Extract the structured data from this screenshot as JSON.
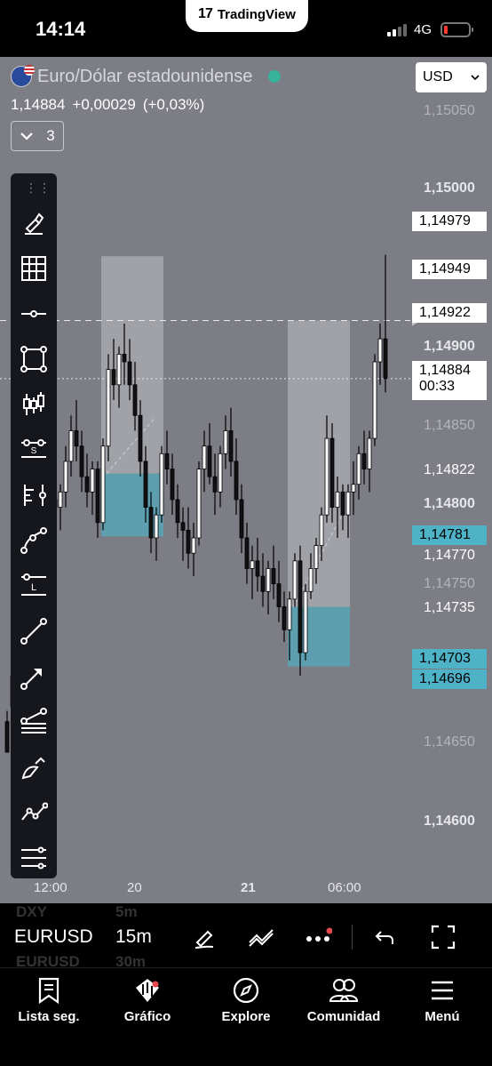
{
  "status_bar": {
    "time": "14:14",
    "app_pill_logo": "17",
    "app_pill_name": "TradingView",
    "network": "4G"
  },
  "symbol": {
    "name": "Euro/Dólar estadounidense",
    "price": "1,14884",
    "change": "+0,00029",
    "change_pct": "(+0,03%)",
    "indicators_count": "3",
    "currency": "USD",
    "market_status_color": "#36b39a"
  },
  "chart_data": {
    "type": "candlestick",
    "instrument": "EURUSD",
    "interval": "15m",
    "ylim": [
      1.14593,
      1.15064
    ],
    "price_axis_ticks": [
      "1,15050",
      "1,15000",
      "1,14950",
      "1,14900",
      "1,14850",
      "1,14800",
      "1,14750",
      "1,14650",
      "1,14600"
    ],
    "price_axis_labels": [
      {
        "text": "1,14979",
        "style": "box"
      },
      {
        "text": "1,14949",
        "style": "box"
      },
      {
        "text": "1,14922",
        "style": "box"
      },
      {
        "text": "1,14884",
        "style": "box",
        "countdown": "00:33"
      },
      {
        "text": "1,14822",
        "style": "plain"
      },
      {
        "text": "1,14781",
        "style": "cyan"
      },
      {
        "text": "1,14770",
        "style": "plain"
      },
      {
        "text": "1,14735",
        "style": "plain"
      },
      {
        "text": "1,14703",
        "style": "cyan"
      },
      {
        "text": "1,14696",
        "style": "cyan"
      }
    ],
    "time_axis_ticks": [
      {
        "text": "12:00",
        "bold": false
      },
      {
        "text": "20",
        "bold": false
      },
      {
        "text": "21",
        "bold": true
      },
      {
        "text": "06:00",
        "bold": false
      }
    ],
    "horizontal_lines": [
      {
        "price": 1.14922,
        "style": "dashed"
      },
      {
        "price": 1.14884,
        "style": "dotted"
      }
    ],
    "position_boxes": [
      {
        "start": 18,
        "end": 29,
        "entry": 1.14822,
        "target": 1.14964,
        "stop": 1.14781
      },
      {
        "start": 53,
        "end": 64,
        "entry": 1.14735,
        "target": 1.14922,
        "stop": 1.14696
      }
    ],
    "candles": [
      [
        1.1466,
        1.14667,
        1.14645,
        1.1464
      ],
      [
        1.1467,
        1.147,
        1.1466,
        1.1469
      ],
      [
        1.147,
        1.1472,
        1.14685,
        1.1471
      ],
      [
        1.1471,
        1.148,
        1.147,
        1.1479
      ],
      [
        1.1479,
        1.14815,
        1.1477,
        1.148
      ],
      [
        1.148,
        1.1484,
        1.14785,
        1.1483
      ],
      [
        1.1483,
        1.14845,
        1.148,
        1.1481
      ],
      [
        1.1481,
        1.1483,
        1.1479,
        1.1482
      ],
      [
        1.1482,
        1.1484,
        1.148,
        1.14805
      ],
      [
        1.14805,
        1.1482,
        1.1479,
        1.148
      ],
      [
        1.148,
        1.14815,
        1.14785,
        1.1481
      ],
      [
        1.1481,
        1.1484,
        1.148,
        1.1483
      ],
      [
        1.1483,
        1.1486,
        1.1482,
        1.1485
      ],
      [
        1.1485,
        1.1487,
        1.1483,
        1.1484
      ],
      [
        1.1484,
        1.1485,
        1.1481,
        1.1482
      ],
      [
        1.1482,
        1.14835,
        1.148,
        1.1481
      ],
      [
        1.1481,
        1.1483,
        1.14795,
        1.14825
      ],
      [
        1.14825,
        1.1483,
        1.1478,
        1.1479
      ],
      [
        1.1479,
        1.14845,
        1.14785,
        1.1484
      ],
      [
        1.1484,
        1.149,
        1.1483,
        1.1489
      ],
      [
        1.1489,
        1.1491,
        1.1487,
        1.1488
      ],
      [
        1.1488,
        1.14905,
        1.14865,
        1.149
      ],
      [
        1.149,
        1.1492,
        1.1488,
        1.14895
      ],
      [
        1.14895,
        1.1491,
        1.1487,
        1.1488
      ],
      [
        1.1488,
        1.14895,
        1.1485,
        1.1486
      ],
      [
        1.1486,
        1.1487,
        1.1482,
        1.1483
      ],
      [
        1.1483,
        1.1484,
        1.1479,
        1.148
      ],
      [
        1.148,
        1.1481,
        1.1477,
        1.1478
      ],
      [
        1.1478,
        1.148,
        1.14765,
        1.14795
      ],
      [
        1.14795,
        1.1484,
        1.1479,
        1.14835
      ],
      [
        1.14835,
        1.1485,
        1.14815,
        1.14825
      ],
      [
        1.14825,
        1.14835,
        1.14795,
        1.14805
      ],
      [
        1.14805,
        1.14815,
        1.1478,
        1.1479
      ],
      [
        1.1479,
        1.148,
        1.14765,
        1.14785
      ],
      [
        1.14785,
        1.148,
        1.1476,
        1.1477
      ],
      [
        1.1477,
        1.1479,
        1.14755,
        1.1478
      ],
      [
        1.1478,
        1.1483,
        1.14775,
        1.14825
      ],
      [
        1.14825,
        1.1485,
        1.1481,
        1.1484
      ],
      [
        1.1484,
        1.14855,
        1.14815,
        1.1482
      ],
      [
        1.1482,
        1.14835,
        1.14795,
        1.1481
      ],
      [
        1.1481,
        1.1484,
        1.148,
        1.14835
      ],
      [
        1.14835,
        1.1486,
        1.14825,
        1.1485
      ],
      [
        1.1485,
        1.14865,
        1.1482,
        1.1483
      ],
      [
        1.1483,
        1.14845,
        1.14795,
        1.14805
      ],
      [
        1.14805,
        1.14815,
        1.1477,
        1.1478
      ],
      [
        1.1478,
        1.1479,
        1.1475,
        1.1476
      ],
      [
        1.1476,
        1.14775,
        1.1474,
        1.14765
      ],
      [
        1.14765,
        1.1478,
        1.14745,
        1.14755
      ],
      [
        1.14755,
        1.1477,
        1.14735,
        1.14745
      ],
      [
        1.14745,
        1.14765,
        1.1473,
        1.1476
      ],
      [
        1.1476,
        1.14775,
        1.1474,
        1.1475
      ],
      [
        1.1475,
        1.14765,
        1.14725,
        1.14735
      ],
      [
        1.14735,
        1.14745,
        1.14712,
        1.1472
      ],
      [
        1.1472,
        1.14745,
        1.147,
        1.1474
      ],
      [
        1.1474,
        1.1477,
        1.14735,
        1.14765
      ],
      [
        1.14765,
        1.14775,
        1.1469,
        1.14705
      ],
      [
        1.14705,
        1.1475,
        1.147,
        1.14745
      ],
      [
        1.14745,
        1.1477,
        1.1474,
        1.1476
      ],
      [
        1.1476,
        1.1478,
        1.1475,
        1.14775
      ],
      [
        1.14775,
        1.148,
        1.14765,
        1.14795
      ],
      [
        1.14795,
        1.1486,
        1.1479,
        1.14845
      ],
      [
        1.14845,
        1.14855,
        1.1479,
        1.148
      ],
      [
        1.148,
        1.1482,
        1.1478,
        1.1481
      ],
      [
        1.1481,
        1.14815,
        1.14785,
        1.14795
      ],
      [
        1.14795,
        1.14815,
        1.1478,
        1.1481
      ],
      [
        1.1481,
        1.1483,
        1.14795,
        1.14815
      ],
      [
        1.14815,
        1.1484,
        1.14805,
        1.14835
      ],
      [
        1.14835,
        1.1485,
        1.14815,
        1.14825
      ],
      [
        1.14825,
        1.1485,
        1.1481,
        1.14845
      ],
      [
        1.14845,
        1.149,
        1.1484,
        1.14895
      ],
      [
        1.14895,
        1.1492,
        1.1488,
        1.1491
      ],
      [
        1.1491,
        1.14965,
        1.14875,
        1.14884
      ]
    ]
  },
  "timeframe_bar": {
    "symbol": "EURUSD",
    "interval": "15m",
    "ghost_rows": [
      {
        "symbol": "DXY",
        "interval": "5m"
      },
      {
        "symbol": "EURUSD",
        "interval": "30m"
      }
    ]
  },
  "nav": {
    "items": [
      {
        "label": "Lista seg.",
        "icon": "bookmark-icon"
      },
      {
        "label": "Gráfico",
        "icon": "chart-icon"
      },
      {
        "label": "Explore",
        "icon": "compass-icon"
      },
      {
        "label": "Comunidad",
        "icon": "community-icon"
      },
      {
        "label": "Menú",
        "icon": "menu-icon"
      }
    ]
  },
  "colors": {
    "chart_bg": "#7c7d85",
    "accent_cyan": "#4fb3c7",
    "notification_dot": "#e5484d"
  }
}
